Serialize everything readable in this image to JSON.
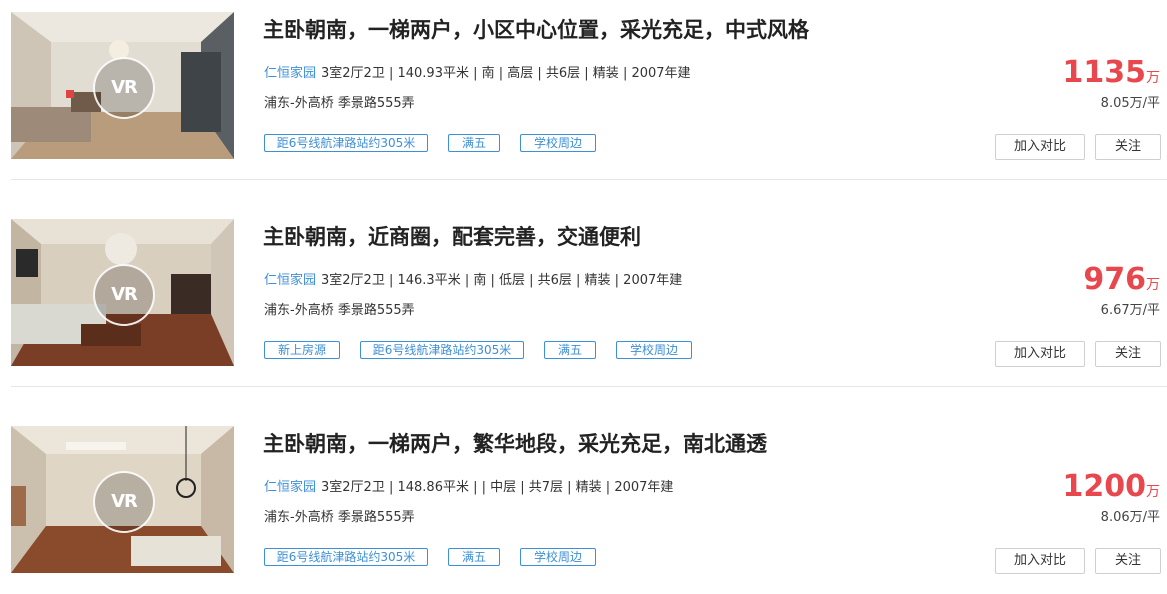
{
  "listings": [
    {
      "title": "主卧朝南，一梯两户，小区中心位置，采光充足，中式风格",
      "community": "仁恒家园",
      "details": "3室2厅2卫 | 140.93平米 | 南 | 高层 | 共6层 | 精装 | 2007年建",
      "location": "浦东-外高桥 季景路555弄",
      "tags": [
        "距6号线航津路站约305米",
        "满五",
        "学校周边"
      ],
      "price": "1135",
      "price_unit": "万",
      "unit_price": "8.05万/平",
      "compare_label": "加入对比",
      "follow_label": "关注",
      "vr_label": "VR"
    },
    {
      "title": "主卧朝南，近商圈，配套完善，交通便利",
      "community": "仁恒家园",
      "details": "3室2厅2卫 | 146.3平米 | 南 | 低层 | 共6层 | 精装 | 2007年建",
      "location": "浦东-外高桥 季景路555弄",
      "tags": [
        "新上房源",
        "距6号线航津路站约305米",
        "满五",
        "学校周边"
      ],
      "price": "976",
      "price_unit": "万",
      "unit_price": "6.67万/平",
      "compare_label": "加入对比",
      "follow_label": "关注",
      "vr_label": "VR"
    },
    {
      "title": "主卧朝南，一梯两户，繁华地段，采光充足，南北通透",
      "community": "仁恒家园",
      "details": "3室2厅2卫 | 148.86平米 | | 中层 | 共7层 | 精装 | 2007年建",
      "location": "浦东-外高桥 季景路555弄",
      "tags": [
        "距6号线航津路站约305米",
        "满五",
        "学校周边"
      ],
      "price": "1200",
      "price_unit": "万",
      "unit_price": "8.06万/平",
      "compare_label": "加入对比",
      "follow_label": "关注",
      "vr_label": "VR"
    }
  ],
  "colors": {
    "accent_blue": "#3d8fd8",
    "price_red": "#e8474e",
    "divider": "#e6e6e6"
  }
}
